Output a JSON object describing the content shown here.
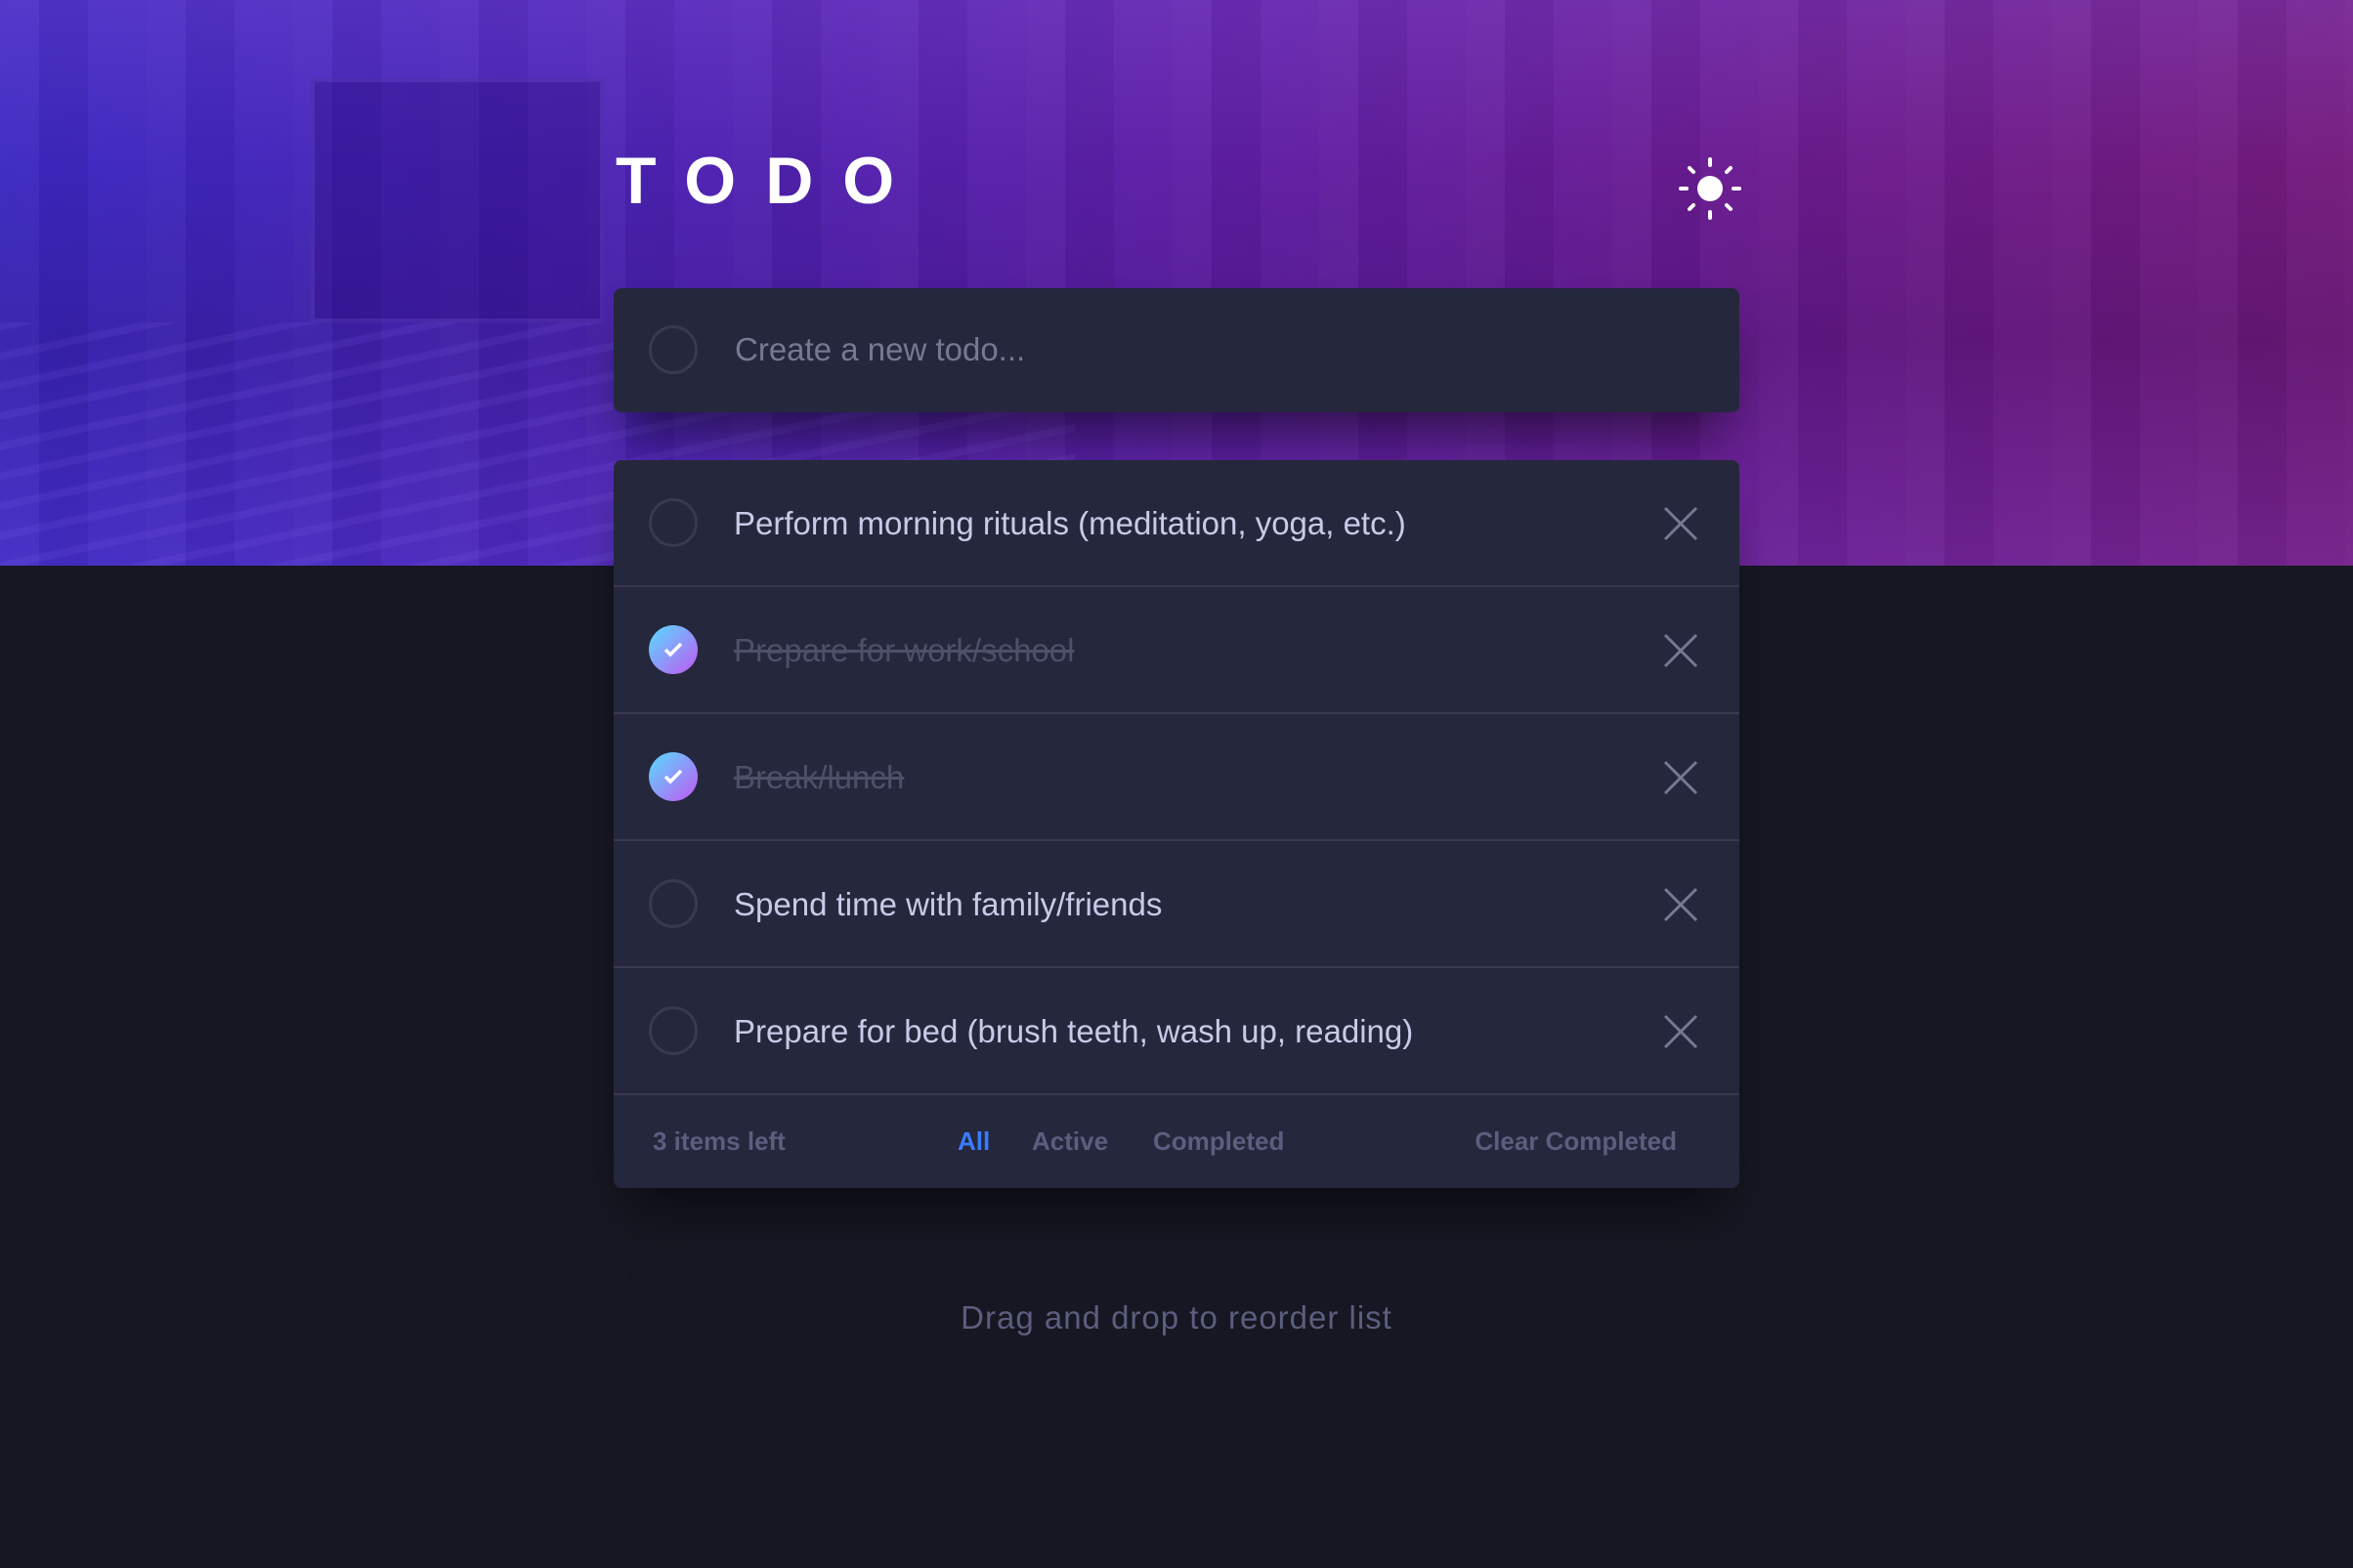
{
  "header": {
    "title": "TODO",
    "theme_toggle_icon": "sun-icon"
  },
  "new_todo": {
    "placeholder": "Create a new todo...",
    "value": ""
  },
  "todos": [
    {
      "text": "Perform morning rituals (meditation, yoga, etc.)",
      "completed": false
    },
    {
      "text": "Prepare for work/school",
      "completed": true
    },
    {
      "text": "Break/lunch",
      "completed": true
    },
    {
      "text": "Spend time with family/friends",
      "completed": false
    },
    {
      "text": "Prepare for bed (brush teeth, wash up, reading)",
      "completed": false
    }
  ],
  "footer": {
    "items_left": "3 items left",
    "filters": [
      {
        "label": "All",
        "active": true
      },
      {
        "label": "Active",
        "active": false
      },
      {
        "label": "Completed",
        "active": false
      }
    ],
    "clear_completed": "Clear Completed"
  },
  "hint": "Drag and drop to reorder list",
  "colors": {
    "accent": "#3a7cfd",
    "check_gradient_start": "#57ddff",
    "check_gradient_end": "#c058f3",
    "card_bg": "#25273c",
    "page_bg": "#161722"
  }
}
